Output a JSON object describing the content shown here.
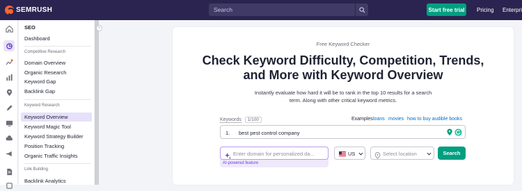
{
  "topbar": {
    "logo_text": "SEMRUSH",
    "search_placeholder": "Search",
    "trial_button": "Start free trial",
    "pricing_link": "Pricing",
    "enterprise_link": "Enterprise"
  },
  "sidebar": {
    "title": "SEO",
    "dashboard": "Dashboard",
    "section_competitive": "Competitive Research",
    "competitive_items": [
      "Domain Overview",
      "Organic Research",
      "Keyword Gap",
      "Backlink Gap"
    ],
    "section_keyword": "Keyword Research",
    "keyword_items": [
      "Keyword Overview",
      "Keyword Magic Tool",
      "Keyword Strategy Builder",
      "Position Tracking",
      "Organic Traffic Insights"
    ],
    "section_link": "Link Building",
    "link_items": [
      "Backlink Analytics"
    ],
    "active_item": "Keyword Overview"
  },
  "rail_icons": [
    "home-icon",
    "seo-icon",
    "traffic-icon",
    "chart-icon",
    "location-pin-icon",
    "pen-icon",
    "monitor-icon",
    "megaphone-icon",
    "report-icon",
    "more-icon"
  ],
  "main": {
    "eyebrow": "Free Keyword Checker",
    "headline_line1": "Check Keyword Difficulty, Competition, Trends,",
    "headline_line2": "and More with Keyword Overview",
    "subtext": "Instantly evaluate how hard it will be to rank in the top 10 results for a search term. Along with other critical keyword metrics.",
    "keywords_label": "Keywords",
    "keywords_count": "1/100",
    "examples_label": "Examples:",
    "examples": [
      "loans",
      "movies",
      "how to buy audible books"
    ],
    "keyword_number": "1.",
    "keyword_value": "best pest control company",
    "domain_placeholder": "Enter domain for personalized da...",
    "ai_note": "AI-powered feature",
    "country_code": "US",
    "location_placeholder": "Select location",
    "search_button": "Search"
  },
  "colors": {
    "topbar": "#2b2450",
    "accent_green": "#009f81",
    "brand_orange": "#ff642d",
    "active_purple": "#e7e0fa",
    "link_blue": "#006dca"
  }
}
